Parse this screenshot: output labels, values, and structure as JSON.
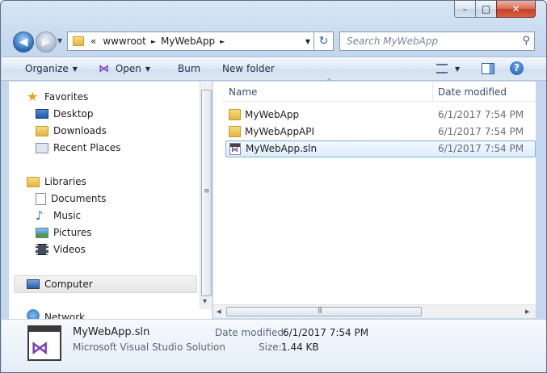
{
  "window": {
    "caption": {
      "minimize": "–",
      "maximize": "□",
      "close": "✕"
    }
  },
  "nav": {
    "back_icon": "back-arrow-icon",
    "forward_icon": "forward-arrow-icon"
  },
  "address": {
    "overflow": "«",
    "segments": [
      "wwwroot",
      "MyWebApp"
    ],
    "separator": "►",
    "dropdown": "▼",
    "refresh_icon": "↻"
  },
  "search": {
    "placeholder": "Search MyWebApp",
    "icon": "⚲"
  },
  "toolbar": {
    "organize": "Organize",
    "open": "Open",
    "burn": "Burn",
    "new_folder": "New folder",
    "dropdown_arrow": "▼",
    "view_icon": "view-details-icon",
    "preview_icon": "preview-pane-icon",
    "help": "?"
  },
  "sidebar": {
    "favorites": {
      "label": "Favorites",
      "items": [
        "Desktop",
        "Downloads",
        "Recent Places"
      ]
    },
    "libraries": {
      "label": "Libraries",
      "items": [
        "Documents",
        "Music",
        "Pictures",
        "Videos"
      ]
    },
    "computer": "Computer",
    "network": "Network"
  },
  "columns": {
    "name": "Name",
    "date": "Date modified",
    "sort_arrow": "^"
  },
  "files": [
    {
      "name": "MyWebApp",
      "date": "6/1/2017 7:54 PM",
      "type": "folder"
    },
    {
      "name": "MyWebAppAPI",
      "date": "6/1/2017 7:54 PM",
      "type": "folder"
    },
    {
      "name": "MyWebApp.sln",
      "date": "6/1/2017 7:54 PM",
      "type": "sln"
    }
  ],
  "details": {
    "name": "MyWebApp.sln",
    "type": "Microsoft Visual Studio Solution",
    "date_label": "Date modified:",
    "date_value": "6/1/2017 7:54 PM",
    "size_label": "Size:",
    "size_value": "1.44 KB"
  },
  "scrollbar": {
    "grip": "≡",
    "hgrip": "|||",
    "left": "◂",
    "right": "▸",
    "up": "▴",
    "down": "▾"
  },
  "colors": {
    "selection": "#dceefc",
    "vs_purple": "#7a3fb5",
    "folder": "#e7b43c"
  }
}
